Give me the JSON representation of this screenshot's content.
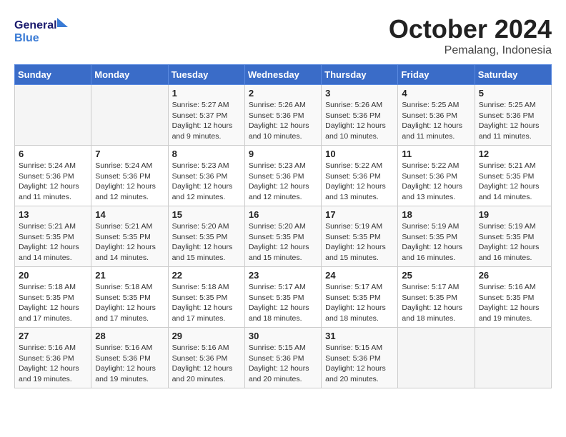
{
  "header": {
    "logo_text1": "General",
    "logo_text2": "Blue",
    "month": "October 2024",
    "location": "Pemalang, Indonesia"
  },
  "weekdays": [
    "Sunday",
    "Monday",
    "Tuesday",
    "Wednesday",
    "Thursday",
    "Friday",
    "Saturday"
  ],
  "weeks": [
    [
      {
        "day": "",
        "info": ""
      },
      {
        "day": "",
        "info": ""
      },
      {
        "day": "1",
        "info": "Sunrise: 5:27 AM\nSunset: 5:37 PM\nDaylight: 12 hours\nand 9 minutes."
      },
      {
        "day": "2",
        "info": "Sunrise: 5:26 AM\nSunset: 5:36 PM\nDaylight: 12 hours\nand 10 minutes."
      },
      {
        "day": "3",
        "info": "Sunrise: 5:26 AM\nSunset: 5:36 PM\nDaylight: 12 hours\nand 10 minutes."
      },
      {
        "day": "4",
        "info": "Sunrise: 5:25 AM\nSunset: 5:36 PM\nDaylight: 12 hours\nand 11 minutes."
      },
      {
        "day": "5",
        "info": "Sunrise: 5:25 AM\nSunset: 5:36 PM\nDaylight: 12 hours\nand 11 minutes."
      }
    ],
    [
      {
        "day": "6",
        "info": "Sunrise: 5:24 AM\nSunset: 5:36 PM\nDaylight: 12 hours\nand 11 minutes."
      },
      {
        "day": "7",
        "info": "Sunrise: 5:24 AM\nSunset: 5:36 PM\nDaylight: 12 hours\nand 12 minutes."
      },
      {
        "day": "8",
        "info": "Sunrise: 5:23 AM\nSunset: 5:36 PM\nDaylight: 12 hours\nand 12 minutes."
      },
      {
        "day": "9",
        "info": "Sunrise: 5:23 AM\nSunset: 5:36 PM\nDaylight: 12 hours\nand 12 minutes."
      },
      {
        "day": "10",
        "info": "Sunrise: 5:22 AM\nSunset: 5:36 PM\nDaylight: 12 hours\nand 13 minutes."
      },
      {
        "day": "11",
        "info": "Sunrise: 5:22 AM\nSunset: 5:36 PM\nDaylight: 12 hours\nand 13 minutes."
      },
      {
        "day": "12",
        "info": "Sunrise: 5:21 AM\nSunset: 5:35 PM\nDaylight: 12 hours\nand 14 minutes."
      }
    ],
    [
      {
        "day": "13",
        "info": "Sunrise: 5:21 AM\nSunset: 5:35 PM\nDaylight: 12 hours\nand 14 minutes."
      },
      {
        "day": "14",
        "info": "Sunrise: 5:21 AM\nSunset: 5:35 PM\nDaylight: 12 hours\nand 14 minutes."
      },
      {
        "day": "15",
        "info": "Sunrise: 5:20 AM\nSunset: 5:35 PM\nDaylight: 12 hours\nand 15 minutes."
      },
      {
        "day": "16",
        "info": "Sunrise: 5:20 AM\nSunset: 5:35 PM\nDaylight: 12 hours\nand 15 minutes."
      },
      {
        "day": "17",
        "info": "Sunrise: 5:19 AM\nSunset: 5:35 PM\nDaylight: 12 hours\nand 15 minutes."
      },
      {
        "day": "18",
        "info": "Sunrise: 5:19 AM\nSunset: 5:35 PM\nDaylight: 12 hours\nand 16 minutes."
      },
      {
        "day": "19",
        "info": "Sunrise: 5:19 AM\nSunset: 5:35 PM\nDaylight: 12 hours\nand 16 minutes."
      }
    ],
    [
      {
        "day": "20",
        "info": "Sunrise: 5:18 AM\nSunset: 5:35 PM\nDaylight: 12 hours\nand 17 minutes."
      },
      {
        "day": "21",
        "info": "Sunrise: 5:18 AM\nSunset: 5:35 PM\nDaylight: 12 hours\nand 17 minutes."
      },
      {
        "day": "22",
        "info": "Sunrise: 5:18 AM\nSunset: 5:35 PM\nDaylight: 12 hours\nand 17 minutes."
      },
      {
        "day": "23",
        "info": "Sunrise: 5:17 AM\nSunset: 5:35 PM\nDaylight: 12 hours\nand 18 minutes."
      },
      {
        "day": "24",
        "info": "Sunrise: 5:17 AM\nSunset: 5:35 PM\nDaylight: 12 hours\nand 18 minutes."
      },
      {
        "day": "25",
        "info": "Sunrise: 5:17 AM\nSunset: 5:35 PM\nDaylight: 12 hours\nand 18 minutes."
      },
      {
        "day": "26",
        "info": "Sunrise: 5:16 AM\nSunset: 5:35 PM\nDaylight: 12 hours\nand 19 minutes."
      }
    ],
    [
      {
        "day": "27",
        "info": "Sunrise: 5:16 AM\nSunset: 5:36 PM\nDaylight: 12 hours\nand 19 minutes."
      },
      {
        "day": "28",
        "info": "Sunrise: 5:16 AM\nSunset: 5:36 PM\nDaylight: 12 hours\nand 19 minutes."
      },
      {
        "day": "29",
        "info": "Sunrise: 5:16 AM\nSunset: 5:36 PM\nDaylight: 12 hours\nand 20 minutes."
      },
      {
        "day": "30",
        "info": "Sunrise: 5:15 AM\nSunset: 5:36 PM\nDaylight: 12 hours\nand 20 minutes."
      },
      {
        "day": "31",
        "info": "Sunrise: 5:15 AM\nSunset: 5:36 PM\nDaylight: 12 hours\nand 20 minutes."
      },
      {
        "day": "",
        "info": ""
      },
      {
        "day": "",
        "info": ""
      }
    ]
  ]
}
